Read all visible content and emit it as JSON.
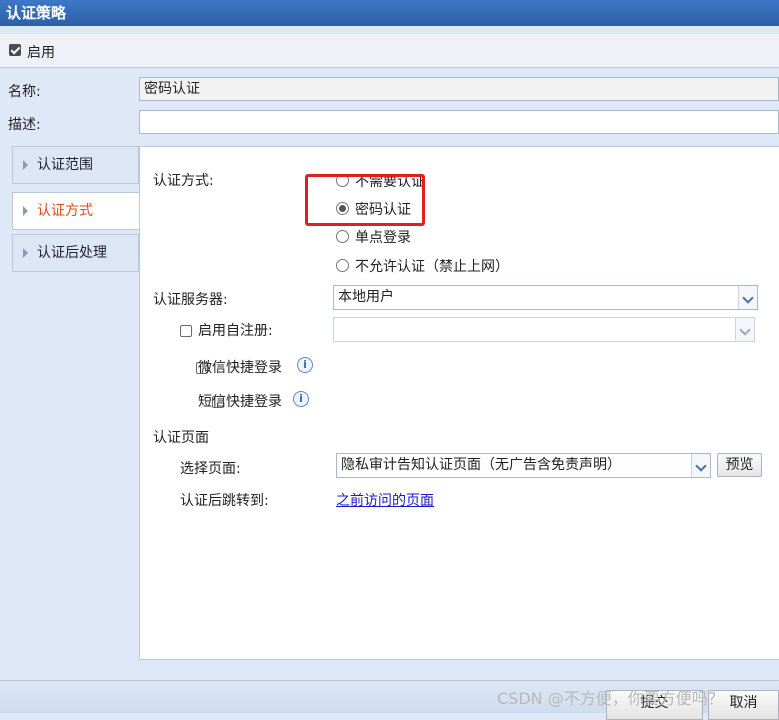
{
  "window": {
    "title": "认证策略"
  },
  "enable": {
    "label": "启用",
    "checked": true
  },
  "form": {
    "name_label": "名称:",
    "name_value": "密码认证",
    "desc_label": "描述:",
    "desc_value": ""
  },
  "nav": {
    "items": [
      {
        "label": "认证范围",
        "active": false
      },
      {
        "label": "认证方式",
        "active": true
      },
      {
        "label": "认证后处理",
        "active": false
      }
    ]
  },
  "auth": {
    "method_label": "认证方式:",
    "options": [
      {
        "label": "不需要认证",
        "checked": false
      },
      {
        "label": "密码认证",
        "checked": true
      },
      {
        "label": "单点登录",
        "checked": false
      },
      {
        "label": "不允许认证（禁止上网）",
        "checked": false
      }
    ],
    "highlight_color": "#e02020",
    "server_label": "认证服务器:",
    "server_value": "本地用户",
    "self_register_label": "启用自注册:",
    "self_register_value": "",
    "wechat_label": "微信快捷登录",
    "sms_label": "短信快捷登录",
    "page_section_label": "认证页面",
    "select_page_label": "选择页面:",
    "select_page_value": "隐私审计告知认证页面（无广告含免责声明）",
    "preview_label": "预览",
    "redirect_label": "认证后跳转到:",
    "redirect_value": "之前访问的页面"
  },
  "footer": {
    "submit_label": "提交",
    "cancel_label": "取消"
  },
  "watermark": "CSDN @不方便，你要方便吗？"
}
